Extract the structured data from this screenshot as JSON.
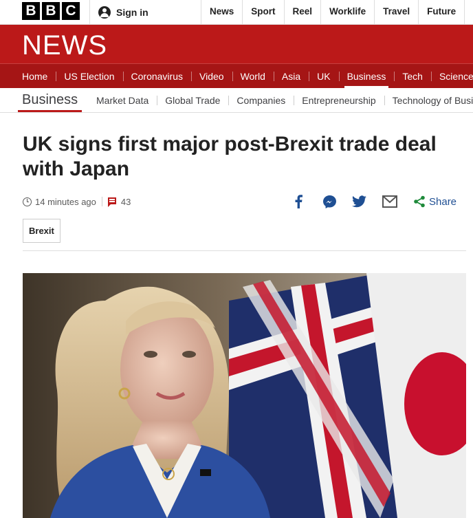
{
  "brand": {
    "logo_letters": [
      "B",
      "B",
      "C"
    ],
    "section_title": "NEWS"
  },
  "signin": {
    "label": "Sign in"
  },
  "topnav": {
    "items": [
      "News",
      "Sport",
      "Reel",
      "Worklife",
      "Travel",
      "Future",
      "M"
    ]
  },
  "secnav": {
    "items": [
      "Home",
      "US Election",
      "Coronavirus",
      "Video",
      "World",
      "Asia",
      "UK",
      "Business",
      "Tech",
      "Science"
    ],
    "active": "Business"
  },
  "subnav": {
    "current": "Business",
    "items": [
      "Market Data",
      "Global Trade",
      "Companies",
      "Entrepreneurship",
      "Technology of Business"
    ]
  },
  "article": {
    "headline": "UK signs first major post-Brexit trade deal with Japan",
    "timestamp": "14 minutes ago",
    "comment_count": "43",
    "share_label": "Share",
    "tag": "Brexit"
  },
  "colors": {
    "brand_red": "#bb1919",
    "nav_red": "#a51515",
    "share_blue": "#1f4f93"
  },
  "icons": [
    "user-icon",
    "clock-icon",
    "comment-icon",
    "facebook-icon",
    "messenger-icon",
    "twitter-icon",
    "email-icon",
    "share-icon"
  ]
}
